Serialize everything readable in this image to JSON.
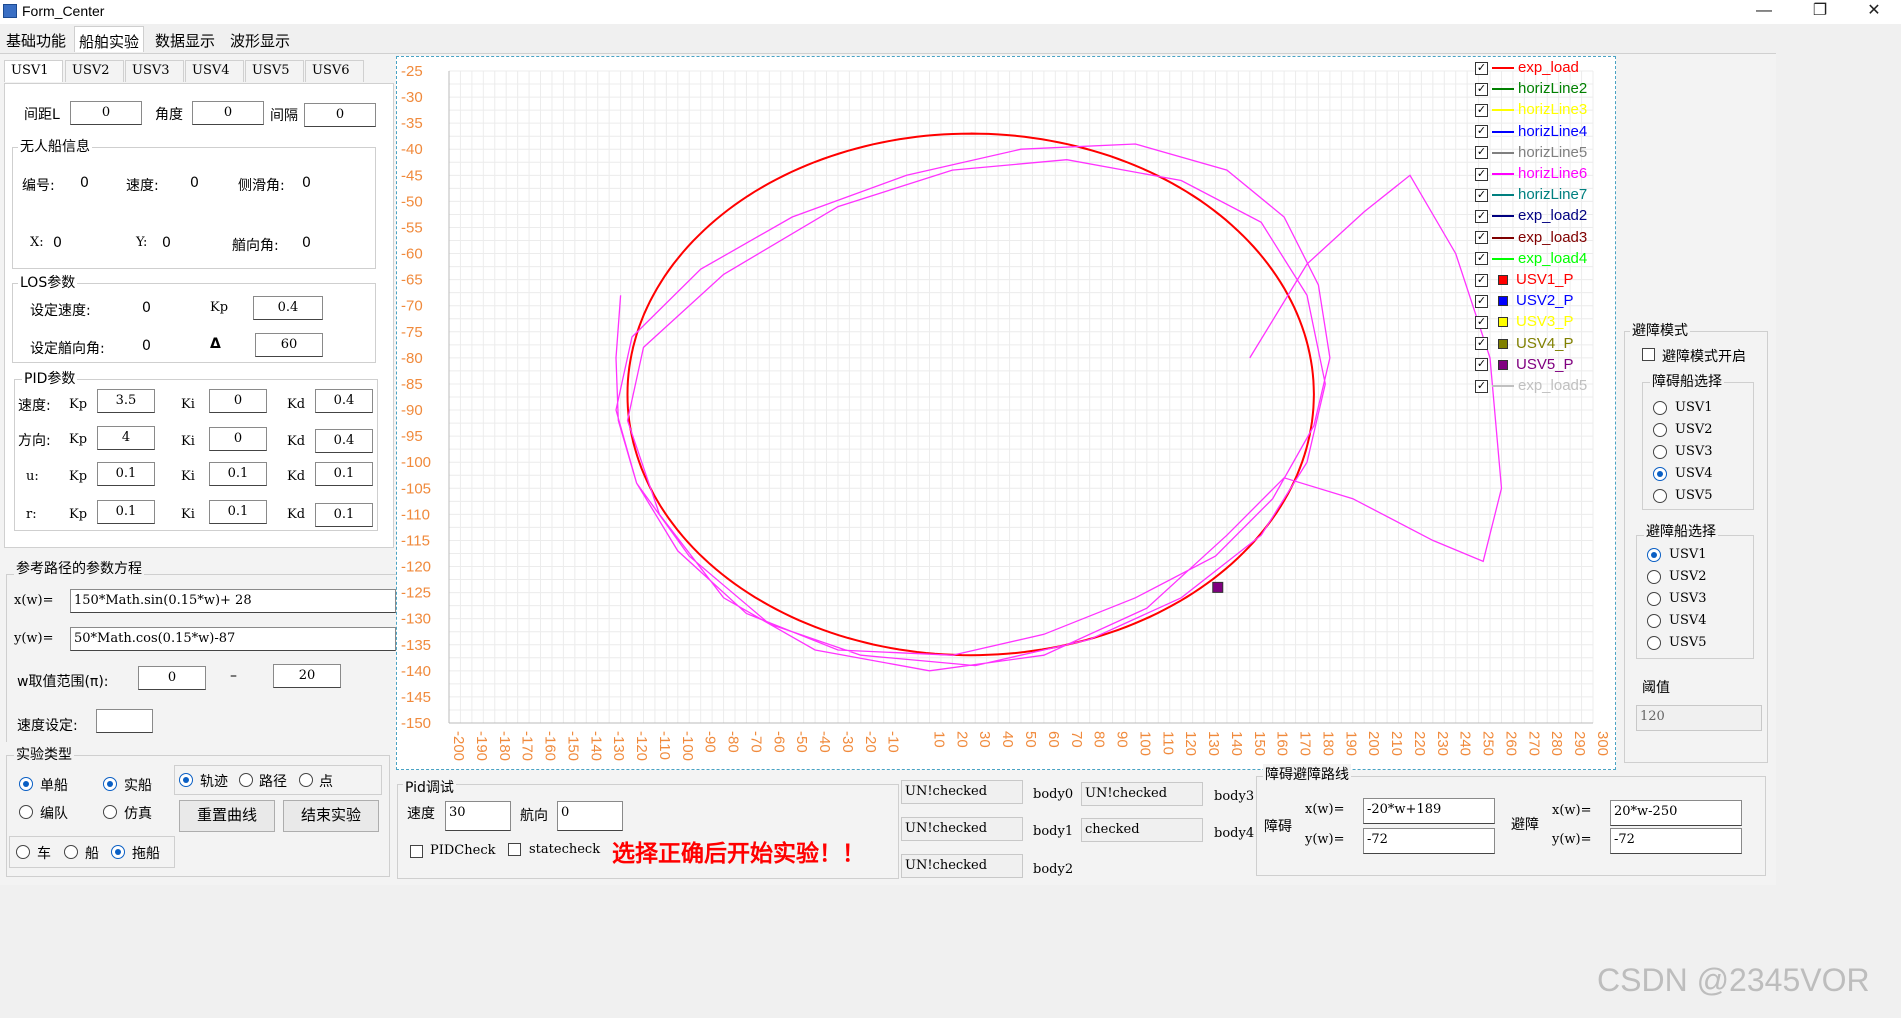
{
  "window": {
    "title": "Form_Center",
    "minimize": "—",
    "maximize": "❐",
    "close": "✕"
  },
  "menu_tabs": [
    {
      "label": "基础功能",
      "active": false
    },
    {
      "label": "船舶实验",
      "active": true
    },
    {
      "label": "数据显示",
      "active": false
    },
    {
      "label": "波形显示",
      "active": false
    }
  ],
  "usv_tabs": [
    "USV1",
    "USV2",
    "USV3",
    "USV4",
    "USV5",
    "USV6"
  ],
  "spacing": {
    "l_label": "间距L",
    "l_value": "0",
    "angle_label": "角度",
    "angle_value": "0",
    "gap_label": "间隔",
    "gap_value": "0"
  },
  "boat_info": {
    "title": "无人船信息",
    "id_label": "编号:",
    "id_value": "0",
    "speed_label": "速度:",
    "speed_value": "0",
    "sideslip_label": "侧滑角:",
    "sideslip_value": "0",
    "x_label": "X:",
    "x_value": "0",
    "y_label": "Y:",
    "y_value": "0",
    "heading_label": "艏向角:",
    "heading_value": "0"
  },
  "los": {
    "title": "LOS参数",
    "speed_label": "设定速度:",
    "speed_value": "0",
    "kp_label": "Kp",
    "kp_value": "0.4",
    "heading_label": "设定艏向角:",
    "heading_value": "0",
    "delta_label": "Δ",
    "delta_value": "60"
  },
  "pid": {
    "title": "PID参数",
    "rows": [
      {
        "name": "速度:",
        "kp": "3.5",
        "ki": "0",
        "kd": "0.4"
      },
      {
        "name": "方向:",
        "kp": "4",
        "ki": "0",
        "kd": "0.4"
      },
      {
        "name": "u:",
        "kp": "0.1",
        "ki": "0.1",
        "kd": "0.1"
      },
      {
        "name": "r:",
        "kp": "0.1",
        "ki": "0.1",
        "kd": "0.1"
      }
    ],
    "kp_label": "Kp",
    "ki_label": "Ki",
    "kd_label": "Kd"
  },
  "ref_path": {
    "title": "参考路径的参数方程",
    "x_label": "x(w)=",
    "x_expr": "150*Math.sin(0.15*w)+ 28",
    "y_label": "y(w)=",
    "y_expr": "50*Math.cos(0.15*w)-87",
    "range_label": "w取值范围(π):",
    "range_from": "0",
    "range_sep": "–",
    "range_to": "20",
    "speed_label": "速度设定:",
    "speed_value": ""
  },
  "experiment": {
    "title": "实验类型",
    "single": "单船",
    "formation": "编队",
    "real": "实船",
    "sim": "仿真",
    "track": "轨迹",
    "path": "路径",
    "point": "点",
    "reset_button": "重置曲线",
    "end_button": "结束实验",
    "car": "车",
    "boat": "船",
    "tow": "拖船"
  },
  "pid_debug": {
    "title": "Pid调试",
    "speed_label": "速度",
    "speed_value": "30",
    "heading_label": "航向",
    "heading_value": "0",
    "pidcheck": "PIDCheck",
    "statecheck": "statecheck",
    "notice": "选择正确后开始实验！！"
  },
  "bodies": [
    {
      "value": "UN!checked",
      "label": "body0"
    },
    {
      "value": "UN!checked",
      "label": "body1"
    },
    {
      "value": "UN!checked",
      "label": "body2"
    },
    {
      "value": "UN!checked",
      "label": "body3"
    },
    {
      "value": "checked",
      "label": "body4"
    }
  ],
  "obstacle_path": {
    "title": "障碍避障路线",
    "obs_label": "障碍",
    "avoid_label": "避障",
    "x_label": "x(w)=",
    "y_label": "y(w)=",
    "obs_x": "-20*w+189",
    "obs_y": "-72",
    "avoid_x": "20*w-250",
    "avoid_y": "-72"
  },
  "avoid_mode": {
    "title": "避障模式",
    "enable_label": "避障模式开启",
    "obstacle_select_title": "障碍船选择",
    "obstacle_options": [
      "USV1",
      "USV2",
      "USV3",
      "USV4",
      "USV5"
    ],
    "obstacle_selected": 3,
    "avoid_select_title": "避障船选择",
    "avoid_options": [
      "USV1",
      "USV2",
      "USV3",
      "USV4",
      "USV5"
    ],
    "avoid_selected": 0,
    "threshold_label": "阈值",
    "threshold_value": "120"
  },
  "colors": {
    "accent": "#0a5fc4",
    "reference": "#ff0000",
    "trajectory": "#ff33ff",
    "tick": "#f08a3c",
    "notice": "#ff0000"
  },
  "chart_data": {
    "type": "line",
    "xlim": [
      -200,
      300
    ],
    "ylim": [
      -150,
      -25
    ],
    "x_ticks": [
      -200,
      -190,
      -180,
      -170,
      -160,
      -150,
      -140,
      -130,
      -120,
      -110,
      -100,
      -90,
      -80,
      -70,
      -60,
      -50,
      -40,
      -30,
      -20,
      -10,
      10,
      20,
      30,
      40,
      50,
      60,
      70,
      80,
      90,
      100,
      110,
      120,
      130,
      140,
      150,
      160,
      170,
      180,
      190,
      200,
      210,
      220,
      230,
      240,
      250,
      260,
      270,
      280,
      290,
      300
    ],
    "y_ticks": [
      -25,
      -30,
      -35,
      -40,
      -45,
      -50,
      -55,
      -60,
      -65,
      -70,
      -75,
      -80,
      -85,
      -90,
      -95,
      -100,
      -105,
      -110,
      -115,
      -120,
      -125,
      -130,
      -135,
      -140,
      -145,
      -150
    ],
    "grid": true,
    "legend_position": "top-right",
    "legend": [
      {
        "name": "exp_load",
        "color": "#ff0000",
        "kind": "line"
      },
      {
        "name": "horizLine2",
        "color": "#008000",
        "kind": "line"
      },
      {
        "name": "horizLine3",
        "color": "#ffff00",
        "kind": "line"
      },
      {
        "name": "horizLine4",
        "color": "#0000ff",
        "kind": "line"
      },
      {
        "name": "horizLine5",
        "color": "#808080",
        "kind": "line"
      },
      {
        "name": "horizLine6",
        "color": "#ff00ff",
        "kind": "line"
      },
      {
        "name": "horizLine7",
        "color": "#008080",
        "kind": "line"
      },
      {
        "name": "exp_load2",
        "color": "#000080",
        "kind": "line"
      },
      {
        "name": "exp_load3",
        "color": "#800000",
        "kind": "line"
      },
      {
        "name": "exp_load4",
        "color": "#00ff00",
        "kind": "line"
      },
      {
        "name": "USV1_P",
        "color": "#ff0000",
        "kind": "square"
      },
      {
        "name": "USV2_P",
        "color": "#0000ff",
        "kind": "square"
      },
      {
        "name": "USV3_P",
        "color": "#ffff00",
        "kind": "square"
      },
      {
        "name": "USV4_P",
        "color": "#808000",
        "kind": "square"
      },
      {
        "name": "USV5_P",
        "color": "#800080",
        "kind": "square"
      },
      {
        "name": "exp_load5",
        "color": "#c0c0c0",
        "kind": "line"
      }
    ],
    "series": [
      {
        "name": "exp_load",
        "formula_x": "150*sin(0.15*w)+28",
        "formula_y": "50*cos(0.15*w)-87",
        "w_range": [
          0,
          62.83
        ]
      },
      {
        "name": "horizLine6",
        "points": [
          [
            -125,
            -68
          ],
          [
            -127,
            -80
          ],
          [
            -126,
            -92
          ],
          [
            -118,
            -104
          ],
          [
            -100,
            -117
          ],
          [
            -70,
            -129
          ],
          [
            -30,
            -136
          ],
          [
            20,
            -137
          ],
          [
            60,
            -133
          ],
          [
            100,
            -126
          ],
          [
            135,
            -118
          ],
          [
            160,
            -107
          ],
          [
            178,
            -93
          ],
          [
            185,
            -80
          ],
          [
            180,
            -66
          ],
          [
            165,
            -53
          ],
          [
            140,
            -44
          ],
          [
            100,
            -39
          ],
          [
            50,
            -40
          ],
          [
            0,
            -45
          ],
          [
            -50,
            -53
          ],
          [
            -90,
            -63
          ],
          [
            -120,
            -76
          ],
          [
            -127,
            -90
          ],
          [
            -118,
            -104
          ],
          [
            -95,
            -118
          ],
          [
            -60,
            -131
          ],
          [
            -20,
            -137
          ],
          [
            30,
            -139
          ],
          [
            80,
            -134
          ],
          [
            120,
            -126
          ],
          [
            155,
            -114
          ],
          [
            175,
            -100
          ],
          [
            183,
            -85
          ],
          [
            175,
            -68
          ],
          [
            155,
            -54
          ],
          [
            120,
            -46
          ],
          [
            70,
            -42
          ],
          [
            20,
            -44
          ],
          [
            -30,
            -51
          ],
          [
            -80,
            -64
          ],
          [
            -115,
            -78
          ],
          [
            -122,
            -92
          ],
          [
            -108,
            -110
          ],
          [
            -80,
            -126
          ],
          [
            -40,
            -136
          ],
          [
            10,
            -140
          ],
          [
            60,
            -137
          ],
          [
            105,
            -128
          ],
          [
            140,
            -114
          ],
          [
            165,
            -103
          ],
          [
            195,
            -107
          ],
          [
            230,
            -115
          ],
          [
            252,
            -119
          ],
          [
            260,
            -105
          ],
          [
            255,
            -80
          ],
          [
            240,
            -60
          ],
          [
            220,
            -45
          ],
          [
            200,
            -52
          ],
          [
            175,
            -62
          ],
          [
            150,
            -80
          ]
        ]
      }
    ],
    "markers": [
      {
        "name": "USV5_P",
        "x": 136,
        "y": -124
      }
    ]
  }
}
